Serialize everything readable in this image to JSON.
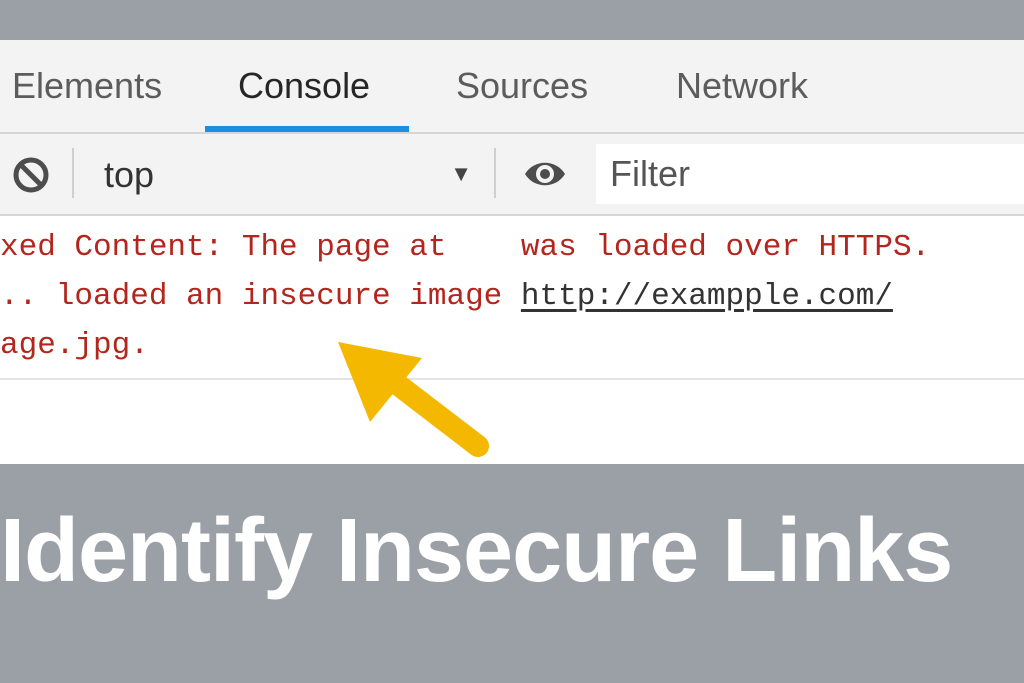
{
  "tabs": [
    {
      "label": "Elements",
      "active": false
    },
    {
      "label": "Console",
      "active": true
    },
    {
      "label": "Sources",
      "active": false
    },
    {
      "label": "Network",
      "active": false
    }
  ],
  "toolbar": {
    "clear_icon": "no-entry-icon",
    "context_value": "top",
    "eye_icon": "eye-icon",
    "filter_placeholder": "Filter"
  },
  "console": {
    "line1": "xed Content: The page at    was loaded over HTTPS.",
    "line2_prefix": ".. loaded an insecure image ",
    "line2_link": "http://exampple.com/",
    "line3": "age.jpg."
  },
  "colors": {
    "accent": "#1a8ee1",
    "error_text": "#b3261e",
    "annotation_arrow": "#f5b800",
    "background": "#9b9fa6"
  },
  "headline": "Identify Insecure Links"
}
